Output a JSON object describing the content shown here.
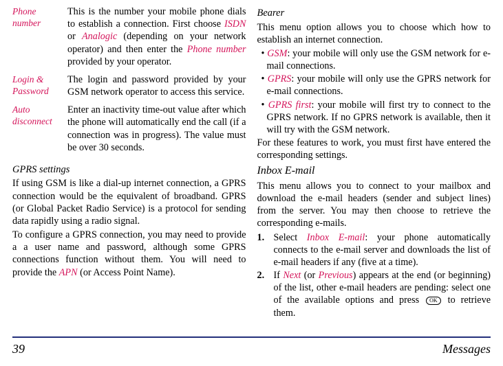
{
  "left_col": {
    "defs": [
      {
        "term": "Phone number",
        "pre": "This is the number your mobile phone dials to establish a connection. First choose ",
        "r1": "ISDN",
        "mid1": " or ",
        "r2": "Analogic",
        "mid2": " (depending on your network operator) and then enter the ",
        "r3": "Phone number",
        "post": " provided by your operator."
      },
      {
        "term": "Login & Password",
        "pre": "The login and password provided by your GSM network operator to access this service.",
        "r1": "",
        "mid1": "",
        "r2": "",
        "mid2": "",
        "r3": "",
        "post": ""
      },
      {
        "term": "Auto disconnect",
        "pre": "Enter an inactivity time-out value after which the phone will automatically end the call (if a connection was in progress). The value must be over 30 seconds.",
        "r1": "",
        "mid1": "",
        "r2": "",
        "mid2": "",
        "r3": "",
        "post": ""
      }
    ],
    "gprs_heading": "GPRS settings",
    "gprs_p1": "If using GSM is like a dial-up internet connection, a GPRS connection would be the equivalent of broadband. GPRS (or Global Packet Radio Service) is a protocol for sending data rapidly using a radio signal.",
    "gprs_p2_pre": "To configure a GPRS connection, you may need to provide a a user name and password, although some GPRS connections function without them. You will need to provide the ",
    "gprs_p2_red": "APN",
    "gprs_p2_post": " (or Access Point Name)."
  },
  "right_col": {
    "bearer_heading": "Bearer",
    "bearer_intro": "This menu option allows you to choose which how to establish an internet connection.",
    "bearer_items": [
      {
        "red": "GSM",
        "rest": ": your mobile will only use the GSM network for e-mail connections."
      },
      {
        "red": "GPRS",
        "rest": ": your mobile will only use the GPRS network for e-mail connections."
      },
      {
        "red": "GPRS first",
        "rest": ": your mobile will first try to connect to the GPRS network. If no GPRS network is available, then it will try with the GSM network."
      }
    ],
    "bearer_outro": "For these features to work, you must first have entered the corresponding settings.",
    "inbox_heading": "Inbox E-mail",
    "inbox_intro": "This menu allows you to connect to your mailbox and download the e-mail headers (sender and subject lines) from the server. You may then choose to retrieve the corresponding e-mails.",
    "num_items": [
      {
        "num": "1.",
        "pre": "Select ",
        "r1": "Inbox E-mail",
        "mid1": ": your phone automatically connects to the e-mail server and downloads the list of e-mail headers if any (five at a time).",
        "r2": "",
        "mid2": "",
        "post": ""
      },
      {
        "num": "2.",
        "pre": "If ",
        "r1": "Next",
        "mid1": " (or ",
        "r2": "Previous",
        "mid2": ") appears at the end (or beginning) of the list, other e-mail headers are pending: select one of the available options and press ",
        "icon": "OK",
        "post": " to retrieve them."
      }
    ]
  },
  "footer": {
    "page": "39",
    "title": "Messages"
  }
}
